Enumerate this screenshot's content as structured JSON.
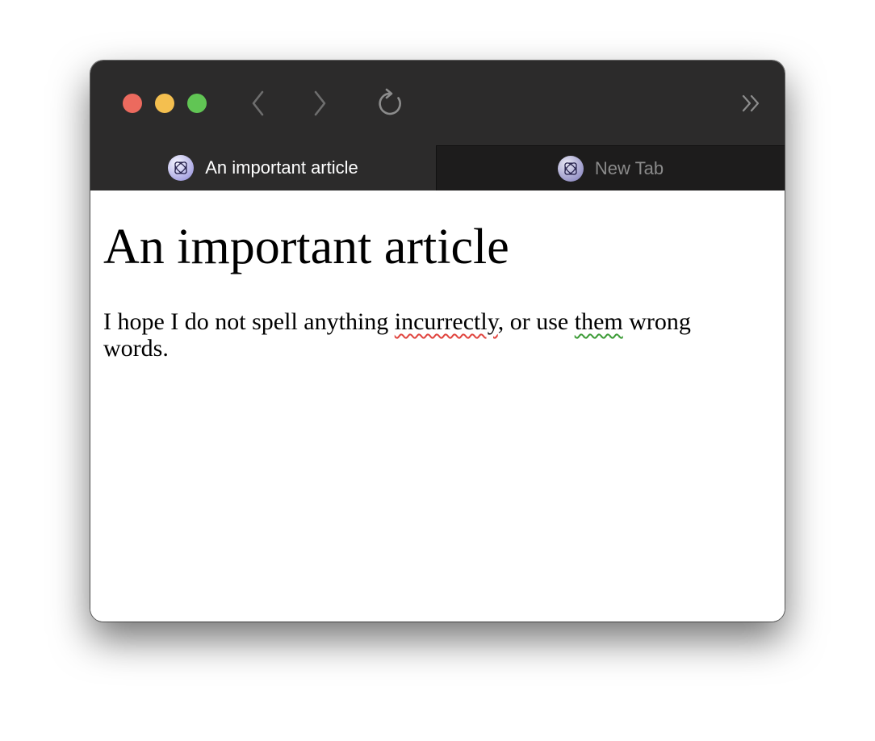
{
  "window": {
    "title_bar": {
      "traffic_lights": [
        {
          "name": "close",
          "color": "#ec6a5e"
        },
        {
          "name": "minimize",
          "color": "#f4bf4f"
        },
        {
          "name": "zoom",
          "color": "#61c554"
        }
      ],
      "toolbar": {
        "back_icon": "chevron-left-icon",
        "forward_icon": "chevron-right-icon",
        "reload_icon": "reload-icon",
        "overflow_icon": "double-chevron-right-icon"
      }
    },
    "tabs": [
      {
        "label": "An important article",
        "active": true,
        "favicon": "browser-favicon"
      },
      {
        "label": "New Tab",
        "active": false,
        "favicon": "browser-favicon"
      }
    ],
    "colors": {
      "chrome": "#2c2b2b",
      "inactive_tab": "#1d1c1c",
      "spelling_underline": "#e0443e",
      "grammar_underline": "#3a9a34"
    }
  },
  "page": {
    "heading": "An important article",
    "paragraph": {
      "part1": "I hope I do not spell anything ",
      "misspelled_word": "incurrectly",
      "part2": ", or use ",
      "grammar_flagged_word": "them",
      "part3": " wrong words."
    }
  }
}
